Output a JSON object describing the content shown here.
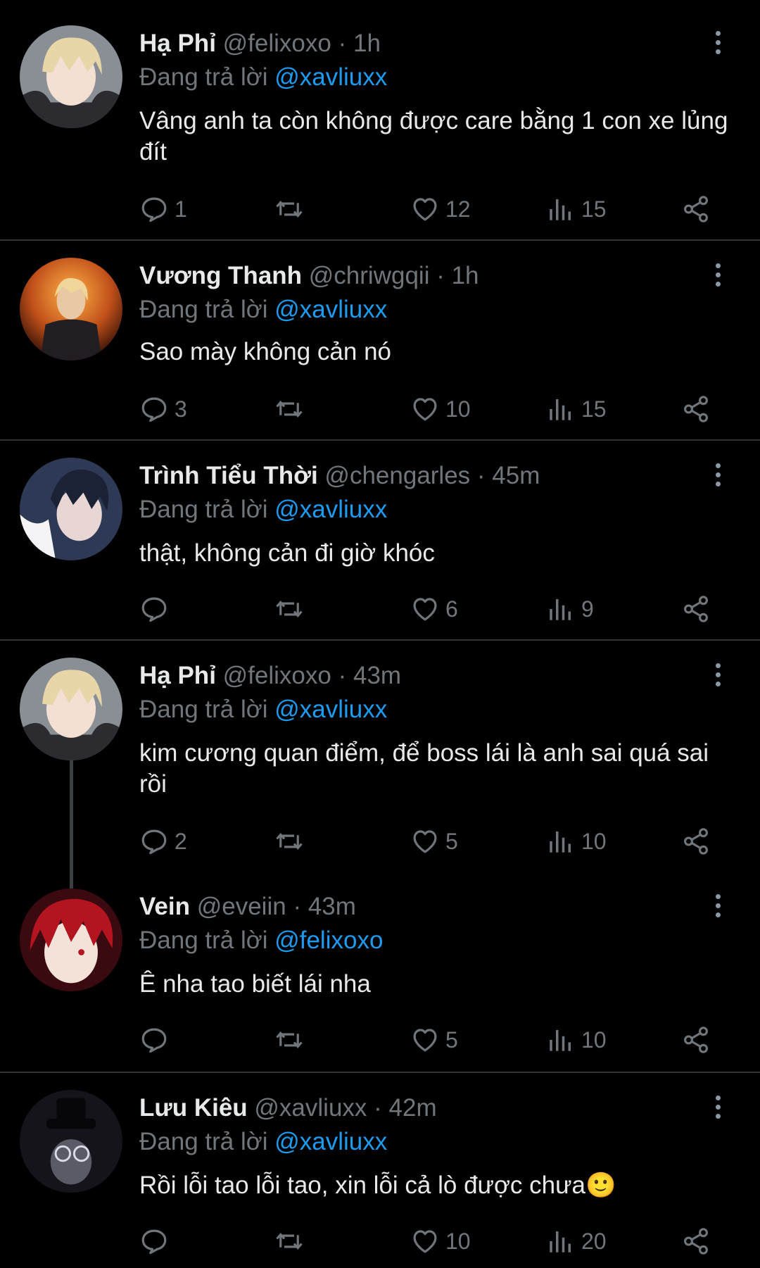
{
  "reply_prefix": "Đang trả lời",
  "colors": {
    "background": "#000000",
    "name": "#e7e9ea",
    "muted": "#71767b",
    "mention": "#1d9bf0",
    "divider": "#2f3336"
  },
  "icons": {
    "reply": "speech-bubble-icon",
    "retweet": "retweet-icon",
    "like": "heart-icon",
    "views": "bar-chart-icon",
    "share": "share-icon",
    "more": "more-vertical-icon"
  },
  "posts": [
    {
      "name": "Hạ Phỉ",
      "handle": "@felixoxo",
      "time": "· 1h",
      "reply_to": "@xavliuxx",
      "text": "Vâng anh ta còn không được care bằng 1 con xe lủng đít",
      "replies": "1",
      "retweets": "",
      "likes": "12",
      "views": "15"
    },
    {
      "name": "Vương Thanh",
      "handle": "@chriwgqii",
      "time": "· 1h",
      "reply_to": "@xavliuxx",
      "text": "Sao mày không cản nó",
      "replies": "3",
      "retweets": "",
      "likes": "10",
      "views": "15"
    },
    {
      "name": "Trình Tiểu Thời",
      "handle": "@chengarles",
      "time": "· 45m",
      "reply_to": "@xavliuxx",
      "text": "thật, không cản đi giờ khóc",
      "replies": "",
      "retweets": "",
      "likes": "6",
      "views": "9"
    },
    {
      "name": "Hạ Phỉ",
      "handle": "@felixoxo",
      "time": "· 43m",
      "reply_to": "@xavliuxx",
      "text": "kim cương quan điểm, để boss lái là anh sai quá sai rồi",
      "replies": "2",
      "retweets": "",
      "likes": "5",
      "views": "10"
    },
    {
      "name": "Vein",
      "handle": "@eveiin",
      "time": "· 43m",
      "reply_to": "@felixoxo",
      "text": "Ê nha tao biết lái nha",
      "replies": "",
      "retweets": "",
      "likes": "5",
      "views": "10"
    },
    {
      "name": "Lưu Kiêu",
      "handle": "@xavliuxx",
      "time": "· 42m",
      "reply_to": "@xavliuxx",
      "text": "Rồi lỗi tao lỗi tao, xin lỗi cả lò được chưa🙂",
      "replies": "",
      "retweets": "",
      "likes": "10",
      "views": "20"
    }
  ]
}
